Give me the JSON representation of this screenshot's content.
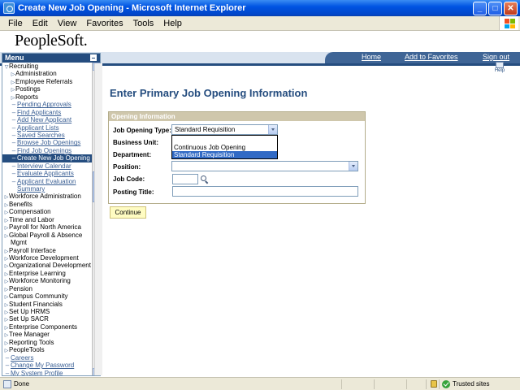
{
  "window": {
    "title": "Create New Job Opening - Microsoft Internet Explorer",
    "minimize_label": "_",
    "maximize_label": "□",
    "close_label": "✕"
  },
  "browser_menu": [
    "File",
    "Edit",
    "View",
    "Favorites",
    "Tools",
    "Help"
  ],
  "header": {
    "logo": "PeopleSoft.",
    "links": {
      "home": "Home",
      "favorites": "Add to Favorites",
      "signout": "Sign out"
    }
  },
  "sidebar": {
    "title": "Menu",
    "items": [
      {
        "label": "Recruiting",
        "kind": "expanded"
      },
      {
        "label": "Administration",
        "kind": "sub-folder"
      },
      {
        "label": "Employee Referrals",
        "kind": "sub-folder"
      },
      {
        "label": "Postings",
        "kind": "sub-folder"
      },
      {
        "label": "Reports",
        "kind": "sub-folder"
      },
      {
        "label": "Pending Approvals",
        "kind": "link"
      },
      {
        "label": "Find Applicants",
        "kind": "link"
      },
      {
        "label": "Add New Applicant",
        "kind": "link"
      },
      {
        "label": "Applicant Lists",
        "kind": "link"
      },
      {
        "label": "Saved Searches",
        "kind": "link"
      },
      {
        "label": "Browse Job Openings",
        "kind": "link"
      },
      {
        "label": "Find Job Openings",
        "kind": "link"
      },
      {
        "label": "Create New Job Opening",
        "kind": "selected"
      },
      {
        "label": "Interview Calendar",
        "kind": "link"
      },
      {
        "label": "Evaluate Applicants",
        "kind": "link"
      },
      {
        "label": "Applicant Evaluation",
        "kind": "link"
      },
      {
        "label": "Summary",
        "kind": "link-cont"
      },
      {
        "label": "Workforce Administration",
        "kind": "folder"
      },
      {
        "label": "Benefits",
        "kind": "folder"
      },
      {
        "label": "Compensation",
        "kind": "folder"
      },
      {
        "label": "Time and Labor",
        "kind": "folder"
      },
      {
        "label": "Payroll for North America",
        "kind": "folder"
      },
      {
        "label": "Global Payroll & Absence",
        "kind": "folder"
      },
      {
        "label": "Mgmt",
        "kind": "folder-cont"
      },
      {
        "label": "Payroll Interface",
        "kind": "folder"
      },
      {
        "label": "Workforce Development",
        "kind": "folder"
      },
      {
        "label": "Organizational Development",
        "kind": "folder"
      },
      {
        "label": "Enterprise Learning",
        "kind": "folder"
      },
      {
        "label": "Workforce Monitoring",
        "kind": "folder"
      },
      {
        "label": "Pension",
        "kind": "folder"
      },
      {
        "label": "Campus Community",
        "kind": "folder"
      },
      {
        "label": "Student Financials",
        "kind": "folder"
      },
      {
        "label": "Set Up HRMS",
        "kind": "folder"
      },
      {
        "label": "Set Up SACR",
        "kind": "folder"
      },
      {
        "label": "Enterprise Components",
        "kind": "folder"
      },
      {
        "label": "Tree Manager",
        "kind": "folder"
      },
      {
        "label": "Reporting Tools",
        "kind": "folder"
      },
      {
        "label": "PeopleTools",
        "kind": "folder"
      },
      {
        "label": "Careers",
        "kind": "top-link"
      },
      {
        "label": "Change My Password",
        "kind": "top-link"
      },
      {
        "label": "My System Profile",
        "kind": "top-link"
      }
    ]
  },
  "main": {
    "help_label": "Help",
    "page_title": "Enter Primary Job Opening Information",
    "group_title": "Opening Information",
    "fields": {
      "job_opening_type_label": "Job Opening Type:",
      "job_opening_type_value": "Standard Requisition",
      "business_unit_label": "Business Unit:",
      "department_label": "Department:",
      "position_label": "Position:",
      "job_code_label": "Job Code:",
      "job_code_value": "",
      "posting_title_label": "Posting Title:",
      "posting_title_value": ""
    },
    "dropdown_options": [
      "Continuous Job Opening",
      "Standard Requisition"
    ],
    "dropdown_selected": "Standard Requisition",
    "continue_label": "Continue"
  },
  "status": {
    "text": "Done",
    "zone": "Trusted sites"
  }
}
